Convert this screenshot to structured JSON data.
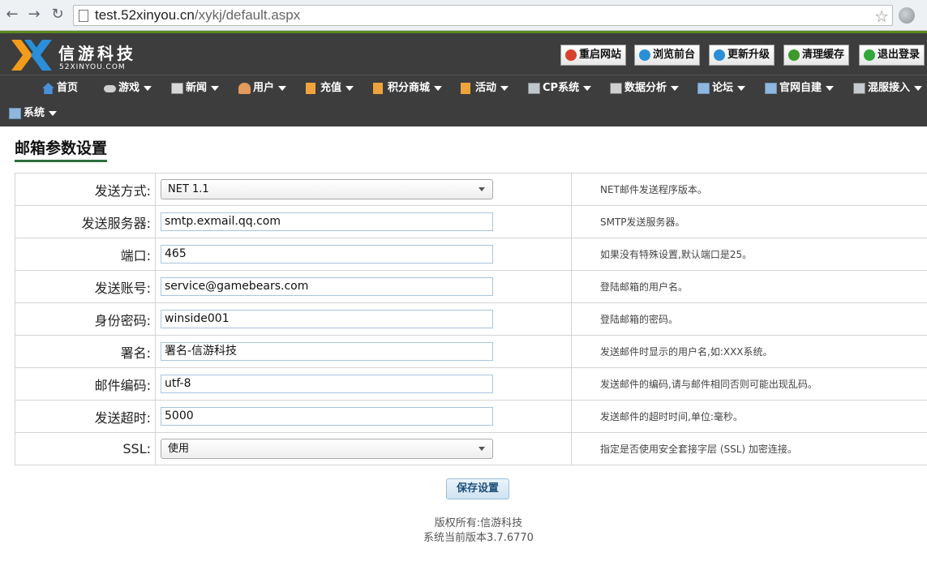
{
  "browser": {
    "url_host": "test.52xinyou.cn",
    "url_path": "/xykj/default.aspx"
  },
  "header": {
    "brand": "信游科技",
    "brand_sub": "52XINYOU.COM",
    "buttons": [
      {
        "label": "重启网站",
        "icon": "power-restart-icon",
        "color": "#d9412e"
      },
      {
        "label": "浏览前台",
        "icon": "globe-icon",
        "color": "#2c8fd6"
      },
      {
        "label": "更新升级",
        "icon": "globe-update-icon",
        "color": "#2c8fd6"
      },
      {
        "label": "清理缓存",
        "icon": "refresh-icon",
        "color": "#3a9a2a"
      },
      {
        "label": "退出登录",
        "icon": "power-icon",
        "color": "#2fa83a"
      }
    ]
  },
  "menu": [
    {
      "label": "首页",
      "icon": "home-icon"
    },
    {
      "label": "游戏",
      "icon": "gamepad-icon"
    },
    {
      "label": "新闻",
      "icon": "news-icon"
    },
    {
      "label": "用户",
      "icon": "user-icon"
    },
    {
      "label": "充值",
      "icon": "document-icon"
    },
    {
      "label": "积分商城",
      "icon": "document-icon"
    },
    {
      "label": "活动",
      "icon": "document-icon"
    },
    {
      "label": "CP系统",
      "icon": "cp-icon"
    },
    {
      "label": "数据分析",
      "icon": "data-icon"
    },
    {
      "label": "论坛",
      "icon": "forum-icon"
    },
    {
      "label": "官网自建",
      "icon": "site-icon"
    },
    {
      "label": "混服接入",
      "icon": "connect-icon"
    },
    {
      "label": "系统",
      "icon": "system-icon"
    }
  ],
  "page": {
    "title": "邮箱参数设置"
  },
  "form": {
    "rows": [
      {
        "label": "发送方式:",
        "type": "select",
        "value": "NET 1.1",
        "hint": "NET邮件发送程序版本。"
      },
      {
        "label": "发送服务器:",
        "type": "text",
        "value": "smtp.exmail.qq.com",
        "hint": "SMTP发送服务器。"
      },
      {
        "label": "端口:",
        "type": "text",
        "value": "465",
        "hint": "如果没有特殊设置,默认端口是25。"
      },
      {
        "label": "发送账号:",
        "type": "text",
        "value": "service@gamebears.com",
        "hint": "登陆邮箱的用户名。"
      },
      {
        "label": "身份密码:",
        "type": "text",
        "value": "winside001",
        "hint": "登陆邮箱的密码。"
      },
      {
        "label": "署名:",
        "type": "text",
        "value": "署名-信游科技",
        "hint": "发送邮件时显示的用户名,如:XXX系统。"
      },
      {
        "label": "邮件编码:",
        "type": "text",
        "value": "utf-8",
        "hint": "发送邮件的编码,请与邮件相同否则可能出现乱码。"
      },
      {
        "label": "发送超时:",
        "type": "text",
        "value": "5000",
        "hint": "发送邮件的超时时间,单位:毫秒。"
      },
      {
        "label": "SSL:",
        "type": "select",
        "value": "使用",
        "hint": "指定是否使用安全套接字层 (SSL) 加密连接。"
      }
    ],
    "save_label": "保存设置"
  },
  "footer": {
    "copyright": "版权所有:信游科技",
    "version": "系统当前版本3.7.6770"
  }
}
